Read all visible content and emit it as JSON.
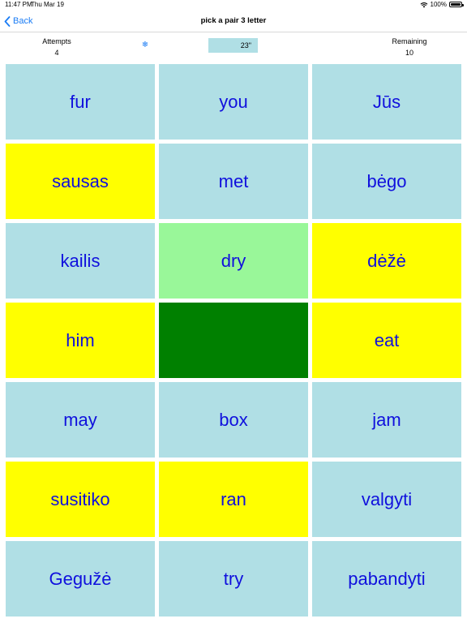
{
  "status": {
    "time": "11:47 PM",
    "date": "Thu Mar 19",
    "battery": "100%"
  },
  "nav": {
    "back_label": "Back",
    "title": "pick a pair 3 letter"
  },
  "stats": {
    "attempts_label": "Attempts",
    "attempts_value": "4",
    "timer": "23\"",
    "remaining_label": "Remaining",
    "remaining_value": "10"
  },
  "colors": {
    "unmatched": "#b0dfe5",
    "selected": "#ffff00",
    "highlighted": "#99f799",
    "matched": "#008000",
    "word_text": "#1010dd",
    "accent": "#1a7cf5"
  },
  "cards": [
    {
      "word": "fur",
      "state": "unmatched"
    },
    {
      "word": "you",
      "state": "unmatched"
    },
    {
      "word": "Jūs",
      "state": "unmatched"
    },
    {
      "word": "sausas",
      "state": "selected"
    },
    {
      "word": "met",
      "state": "unmatched"
    },
    {
      "word": "bėgo",
      "state": "unmatched"
    },
    {
      "word": "kailis",
      "state": "unmatched"
    },
    {
      "word": "dry",
      "state": "highlighted"
    },
    {
      "word": "dėžė",
      "state": "selected"
    },
    {
      "word": "him",
      "state": "selected"
    },
    {
      "word": "",
      "state": "matched"
    },
    {
      "word": "eat",
      "state": "selected"
    },
    {
      "word": "may",
      "state": "unmatched"
    },
    {
      "word": "box",
      "state": "unmatched"
    },
    {
      "word": "jam",
      "state": "unmatched"
    },
    {
      "word": "susitiko",
      "state": "selected"
    },
    {
      "word": "ran",
      "state": "selected"
    },
    {
      "word": "valgyti",
      "state": "unmatched"
    },
    {
      "word": "Gegužė",
      "state": "unmatched"
    },
    {
      "word": "try",
      "state": "unmatched"
    },
    {
      "word": "pabandyti",
      "state": "unmatched"
    }
  ]
}
